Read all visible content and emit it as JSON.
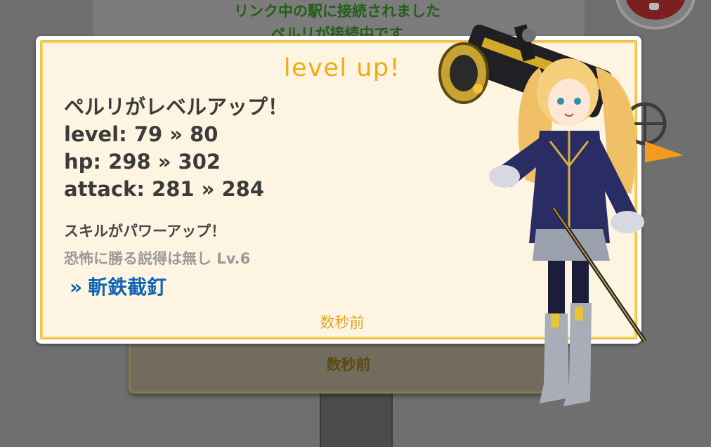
{
  "background": {
    "notice_line1": "リンク中の駅に接続されました",
    "notice_line2": "ペルリが接続中です",
    "card_time": "数秒前"
  },
  "dialog": {
    "title": "level up!",
    "headline": "ペルリがレベルアップ！",
    "level": "level: 79 » 80",
    "hp": "hp: 298 » 302",
    "attack": "attack: 281 » 284",
    "skill_heading": "スキルがパワーアップ！",
    "skill_old": "恐怖に勝る説得は無し Lv.6",
    "skill_new_arrow": "»",
    "skill_new": "斬鉄截釘",
    "time": "数秒前"
  },
  "colors": {
    "title": "#f2ab12",
    "link": "#0f63b5",
    "dialog_bg": "#fdf5e1",
    "dialog_border": "#f6cf63"
  },
  "icons": {
    "corner_button": "close-button-icon",
    "character": "character-illustration"
  }
}
